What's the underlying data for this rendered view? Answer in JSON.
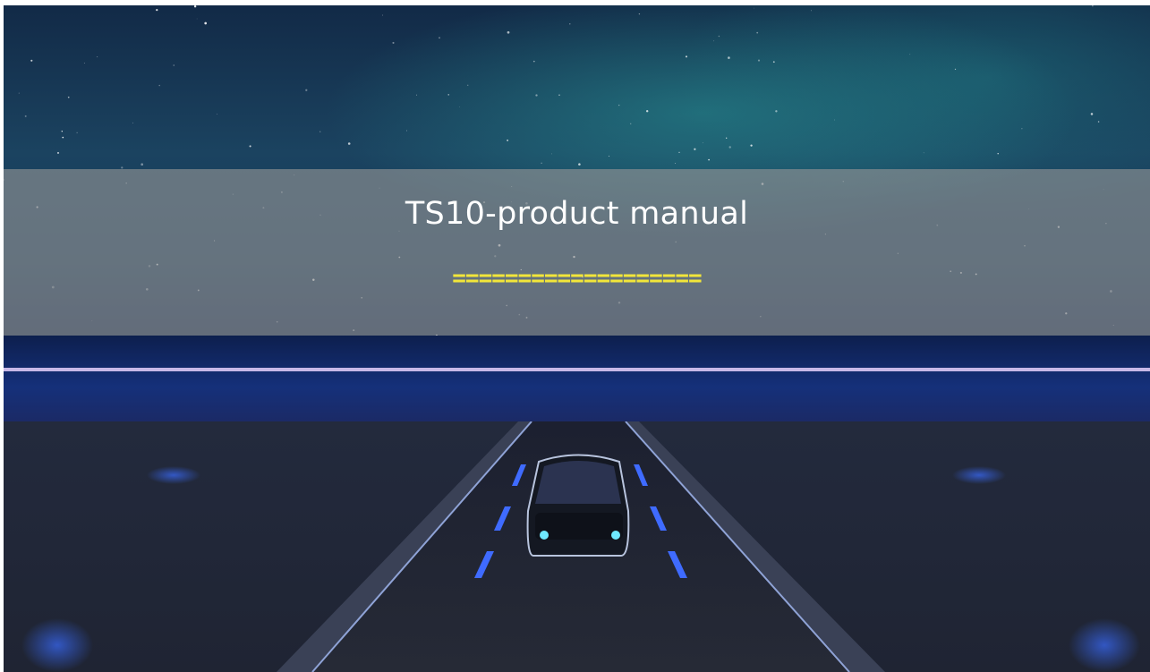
{
  "slide": {
    "title": "TS10-product manual",
    "divider": "==================="
  },
  "colors": {
    "title": "#ffffff",
    "divider": "#f2e63a",
    "banner": "#9a9a9a",
    "accent_line": "#c8b8e8"
  },
  "icons": [
    "car-illustration",
    "road-illustration",
    "starfield-background"
  ]
}
